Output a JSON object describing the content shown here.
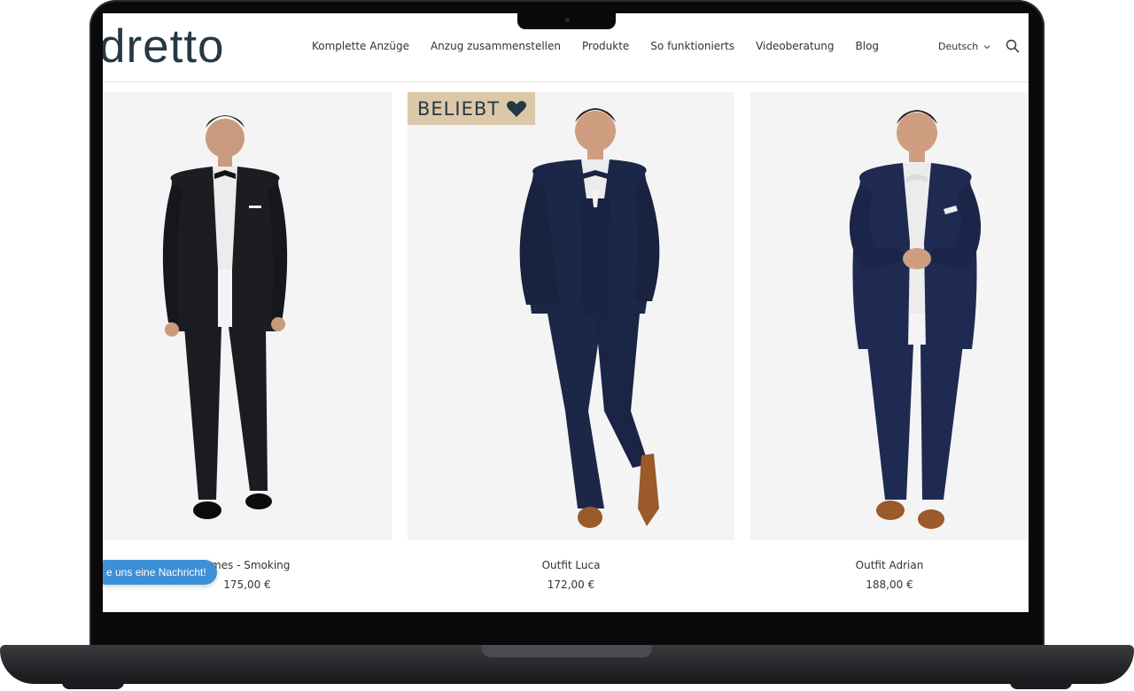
{
  "brand": {
    "logo_text": "dretto"
  },
  "nav": {
    "items": [
      {
        "label": "Komplette Anzüge"
      },
      {
        "label": "Anzug zusammenstellen"
      },
      {
        "label": "Produkte"
      },
      {
        "label": "So funktionierts"
      },
      {
        "label": "Videoberatung"
      },
      {
        "label": "Blog"
      }
    ],
    "language": "Deutsch"
  },
  "products": [
    {
      "name": "ames - Smoking",
      "price": "175,00 €",
      "suit_color": "#1b1d22",
      "badge": ""
    },
    {
      "name": "Outfit Luca",
      "price": "172,00 €",
      "suit_color": "#1c2748",
      "badge": "BELIEBT"
    },
    {
      "name": "Outfit Adrian",
      "price": "188,00 €",
      "suit_color": "#1e2a52",
      "badge": ""
    }
  ],
  "chat": {
    "label": "e uns eine Nachricht!"
  },
  "colors": {
    "brand": "#253945",
    "badge_bg": "#dcc8a8",
    "chat_bg": "#3d8fd6"
  }
}
